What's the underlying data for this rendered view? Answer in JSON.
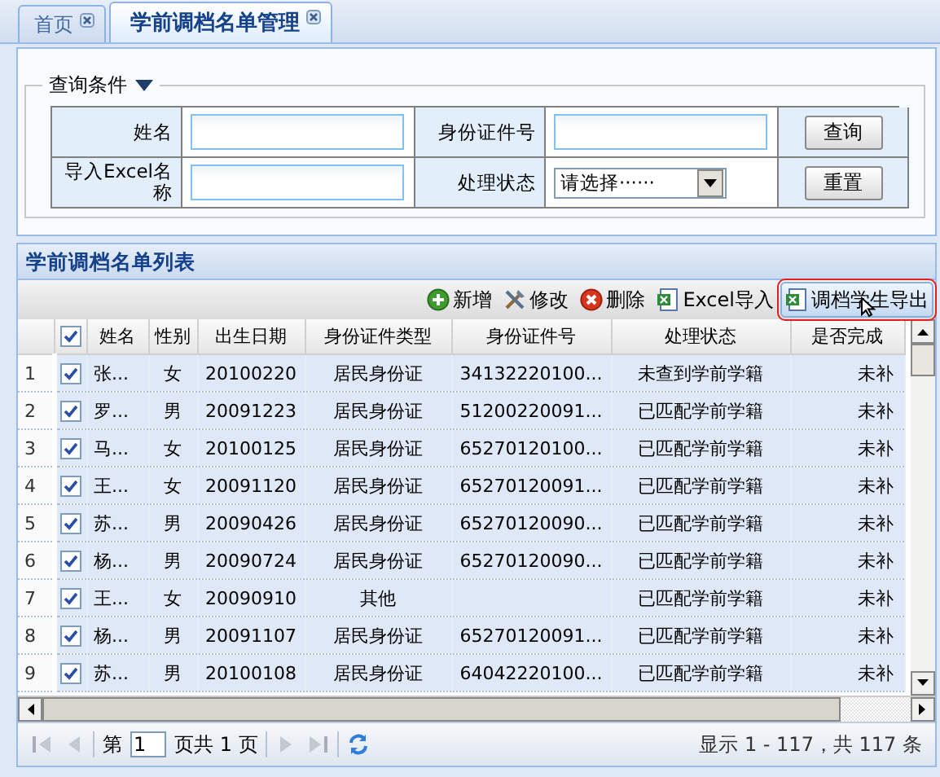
{
  "tabs": [
    {
      "label": "首页",
      "selected": false
    },
    {
      "label": "学前调档名单管理",
      "selected": true
    }
  ],
  "query": {
    "title": "查询条件",
    "expanded": true,
    "fields": [
      {
        "label": "姓名",
        "kind": "text"
      },
      {
        "label": "身份证件号",
        "kind": "text"
      },
      {
        "label": "导入Excel名称",
        "kind": "text"
      },
      {
        "label": "处理状态",
        "kind": "select",
        "value": "请选择······"
      }
    ],
    "buttons": [
      "查询",
      "重置"
    ]
  },
  "grid": {
    "title": "学前调档名单列表",
    "toolbar": [
      {
        "label": "新增",
        "kind": "add",
        "highlighted": false
      },
      {
        "label": "修改",
        "kind": "edit",
        "highlighted": false
      },
      {
        "label": "删除",
        "kind": "delete",
        "highlighted": false
      },
      {
        "label": "Excel导入",
        "kind": "import",
        "highlighted": false
      },
      {
        "label": "调档学生导出",
        "kind": "export",
        "highlighted": true
      }
    ],
    "all_checked": true,
    "columns": [
      "姓名",
      "性别",
      "出生日期",
      "身份证件类型",
      "身份证件号",
      "处理状态",
      "是否完成"
    ],
    "rows": [
      {
        "number": "1",
        "checked": true,
        "cells": [
          "张...",
          "女",
          "20100220",
          "居民身份证",
          "34132220100...",
          "未查到学前学籍",
          "未补"
        ]
      },
      {
        "number": "2",
        "checked": true,
        "cells": [
          "罗...",
          "男",
          "20091223",
          "居民身份证",
          "51200220091...",
          "已匹配学前学籍",
          "未补"
        ]
      },
      {
        "number": "3",
        "checked": true,
        "cells": [
          "马...",
          "女",
          "20100125",
          "居民身份证",
          "65270120100...",
          "已匹配学前学籍",
          "未补"
        ]
      },
      {
        "number": "4",
        "checked": true,
        "cells": [
          "王...",
          "女",
          "20091120",
          "居民身份证",
          "65270120091...",
          "已匹配学前学籍",
          "未补"
        ]
      },
      {
        "number": "5",
        "checked": true,
        "cells": [
          "苏...",
          "男",
          "20090426",
          "居民身份证",
          "65270120090...",
          "已匹配学前学籍",
          "未补"
        ]
      },
      {
        "number": "6",
        "checked": true,
        "cells": [
          "杨...",
          "男",
          "20090724",
          "居民身份证",
          "65270120090...",
          "已匹配学前学籍",
          "未补"
        ]
      },
      {
        "number": "7",
        "checked": true,
        "cells": [
          "王...",
          "女",
          "20090910",
          "其他",
          "",
          "已匹配学前学籍",
          "未补"
        ]
      },
      {
        "number": "8",
        "checked": true,
        "cells": [
          "杨...",
          "男",
          "20091107",
          "居民身份证",
          "65270120091...",
          "已匹配学前学籍",
          "未补"
        ]
      },
      {
        "number": "9",
        "checked": true,
        "cells": [
          "苏...",
          "男",
          "20100108",
          "居民身份证",
          "64042220100...",
          "已匹配学前学籍",
          "未补"
        ]
      }
    ],
    "pager": {
      "page_prefix": "第",
      "page": "1",
      "page_suffix": "页共 1 页",
      "summary": "显示 1 - 117，共 117 条"
    }
  }
}
